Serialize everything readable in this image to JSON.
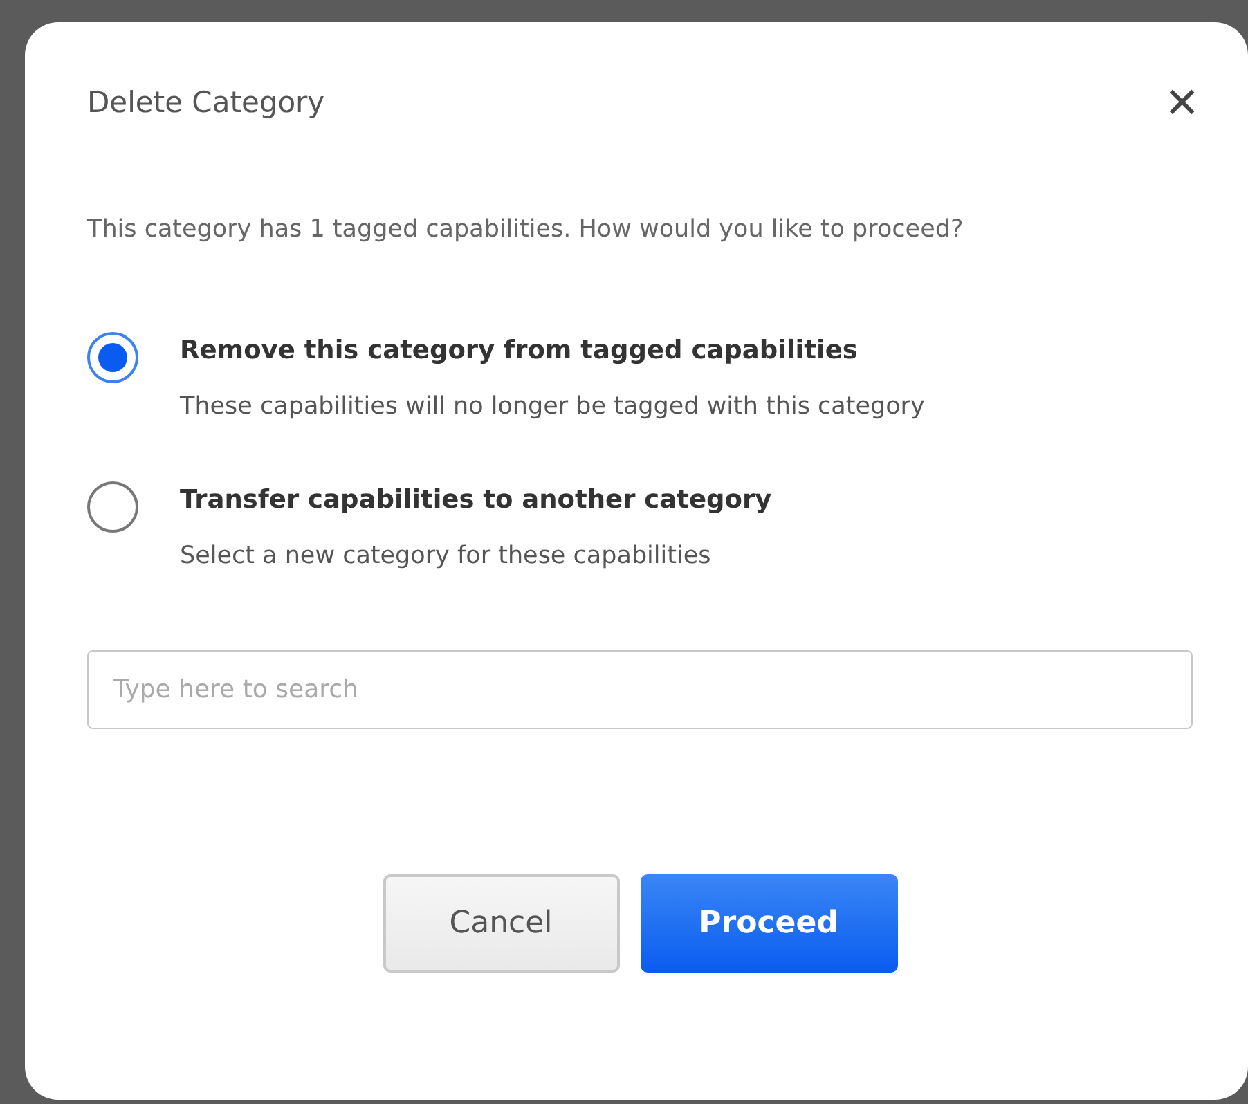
{
  "dialog": {
    "title": "Delete Category",
    "close": "×",
    "message": "This category has 1 tagged capabilities. How would you like to proceed?",
    "options": [
      {
        "label": "Remove this category from tagged capabilities",
        "description": "These capabilities will no longer be tagged with this category",
        "selected": true
      },
      {
        "label": "Transfer capabilities to another category",
        "description": "Select a new category for these capabilities",
        "selected": false
      }
    ],
    "search": {
      "placeholder": "Type here to search"
    },
    "buttons": [
      {
        "label": "Cancel",
        "kind": "secondary"
      },
      {
        "label": "Proceed",
        "kind": "primary"
      }
    ]
  }
}
